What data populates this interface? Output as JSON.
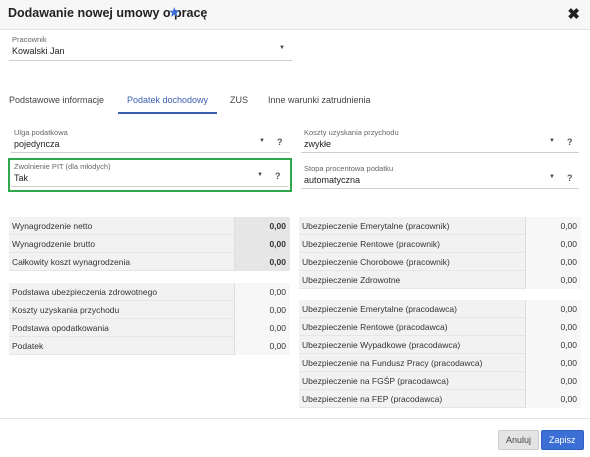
{
  "dialog": {
    "title": "Dodawanie nowej umowy o pracę",
    "star_icon": "★",
    "close_icon": "✖"
  },
  "employee": {
    "label": "Pracownik",
    "value": "Kowalski Jan"
  },
  "tabs": [
    {
      "label": "Podstawowe informacje"
    },
    {
      "label": "Podatek dochodowy"
    },
    {
      "label": "ZUS"
    },
    {
      "label": "Inne warunki zatrudnienia"
    }
  ],
  "tax": {
    "relief": {
      "label": "Ulga podatkowa",
      "value": "pojedyncza"
    },
    "pit_exemption": {
      "label": "Zwolnienie PIT (dla młodych)",
      "value": "Tak"
    },
    "costs": {
      "label": "Koszty uzyskania przychodu",
      "value": "zwykłe"
    },
    "rate": {
      "label": "Stopa procentowa podatku",
      "value": "automatyczna"
    }
  },
  "summary_left_1": [
    {
      "label": "Wynagrodzenie netto",
      "value": "0,00"
    },
    {
      "label": "Wynagrodzenie brutto",
      "value": "0,00"
    },
    {
      "label": "Całkowity koszt wynagrodzenia",
      "value": "0,00"
    }
  ],
  "summary_left_2": [
    {
      "label": "Podstawa ubezpieczenia zdrowotnego",
      "value": "0,00"
    },
    {
      "label": "Koszty uzyskania przychodu",
      "value": "0,00"
    },
    {
      "label": "Podstawa opodatkowania",
      "value": "0,00"
    },
    {
      "label": "Podatek",
      "value": "0,00"
    }
  ],
  "summary_right_1": [
    {
      "label": "Ubezpieczenie Emerytalne (pracownik)",
      "value": "0,00"
    },
    {
      "label": "Ubezpieczenie Rentowe (pracownik)",
      "value": "0,00"
    },
    {
      "label": "Ubezpieczenie Chorobowe (pracownik)",
      "value": "0,00"
    },
    {
      "label": "Ubezpieczenie Zdrowotne",
      "value": "0,00"
    }
  ],
  "summary_right_2": [
    {
      "label": "Ubezpieczenie Emerytalne (pracodawca)",
      "value": "0,00"
    },
    {
      "label": "Ubezpieczenie Rentowe (pracodawca)",
      "value": "0,00"
    },
    {
      "label": "Ubezpieczenie Wypadkowe (pracodawca)",
      "value": "0,00"
    },
    {
      "label": "Ubezpieczenie na Fundusz Pracy (pracodawca)",
      "value": "0,00"
    },
    {
      "label": "Ubezpieczenie na FGŚP (pracodawca)",
      "value": "0,00"
    },
    {
      "label": "Ubezpieczenie na FEP (pracodawca)",
      "value": "0,00"
    }
  ],
  "footer": {
    "cancel_label": "Anuluj",
    "save_label": "Zapisz"
  },
  "colors": {
    "accent": "#3b6fd6",
    "highlight": "#2ea84a"
  }
}
